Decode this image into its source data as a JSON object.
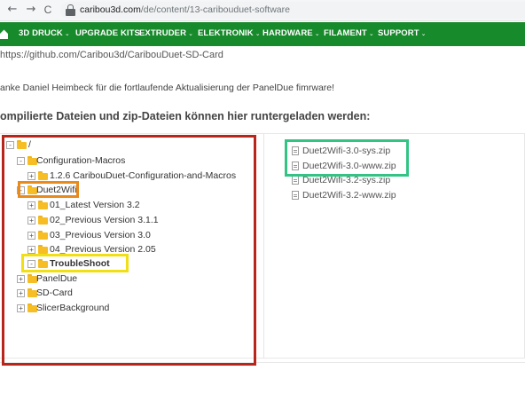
{
  "browser": {
    "back_glyph": "←",
    "forward_glyph": "→",
    "reload_glyph": "C",
    "home_glyph": "⌂",
    "url_host": "caribou3d.com",
    "url_path": "/de/content/13-caribouduet-software"
  },
  "nav": {
    "items": [
      {
        "label": "3D DRUCK",
        "caret": "⌄"
      },
      {
        "label": "UPGRADE KITS",
        "caret": ""
      },
      {
        "label": "EXTRUDER",
        "caret": "⌄"
      },
      {
        "label": "ELEKTRONIK",
        "caret": "⌄"
      },
      {
        "label": "HARDWARE",
        "caret": "⌄"
      },
      {
        "label": "FILAMENT",
        "caret": "⌄"
      },
      {
        "label": "SUPPORT",
        "caret": "⌄"
      }
    ],
    "accent_color": "#178a2b"
  },
  "content": {
    "link_line": "https://github.com/Caribou3d/CaribouDuet-SD-Card",
    "thanks_line": "anke Daniel Heimbeck für die fortlaufende Aktualisierung der PanelDue fimrware!",
    "heading": "ompilierte Dateien und zip-Dateien können hier runtergeladen werden:"
  },
  "tree": {
    "rows": [
      {
        "exp": "-",
        "label": "/"
      },
      {
        "exp": "-",
        "label": "Configuration-Macros"
      },
      {
        "exp": "+",
        "label": "1.2.6 CaribouDuet-Configuration-and-Macros"
      },
      {
        "exp": "-",
        "label": "Duet2Wifi"
      },
      {
        "exp": "+",
        "label": "01_Latest Version 3.2"
      },
      {
        "exp": "+",
        "label": "02_Previous Version 3.1.1"
      },
      {
        "exp": "+",
        "label": "03_Previous Version 3.0"
      },
      {
        "exp": "+",
        "label": "04_Previous Version 2.05"
      },
      {
        "exp": "-",
        "label": "TroubleShoot"
      },
      {
        "exp": "+",
        "label": "PanelDue"
      },
      {
        "exp": "+",
        "label": "SD-Card"
      },
      {
        "exp": "+",
        "label": "SlicerBackground"
      }
    ]
  },
  "files": {
    "items": [
      {
        "label": "Duet2Wifi-3.0-sys.zip"
      },
      {
        "label": "Duet2Wifi-3.0-www.zip"
      },
      {
        "label": "Duet2Wifi-3.2-sys.zip"
      },
      {
        "label": "Duet2Wifi-3.2-www.zip"
      }
    ]
  },
  "annotation_colors": {
    "red": "#b8261b",
    "orange": "#e98a1c",
    "yellow": "#f1df16",
    "green": "#33c485"
  }
}
